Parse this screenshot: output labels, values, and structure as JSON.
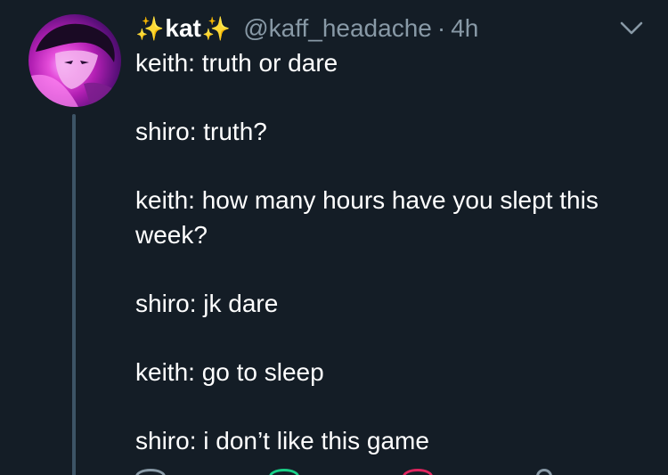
{
  "tweet": {
    "author": {
      "display_name": "kat",
      "name_decoration_left": "✨",
      "name_decoration_right": "✨",
      "handle": "@kaff_headache"
    },
    "separator": "·",
    "timestamp": "4h",
    "lines": [
      "keith: truth or dare",
      "shiro: truth?",
      "keith: how many hours have you slept this week?",
      "shiro: jk dare",
      "keith: go to sleep",
      "shiro: i don’t like this game"
    ],
    "icons": {
      "menu": "chevron-down-icon",
      "actions": [
        "reply-icon",
        "retweet-icon",
        "like-icon",
        "share-icon"
      ]
    }
  },
  "colors": {
    "background": "#141d26",
    "text_primary": "#ffffff",
    "text_secondary": "#8899a6",
    "thread_line": "#3d5466",
    "sparkle": "#f5c518",
    "retweet_green": "#19cf86",
    "like_pink": "#e0245e"
  }
}
